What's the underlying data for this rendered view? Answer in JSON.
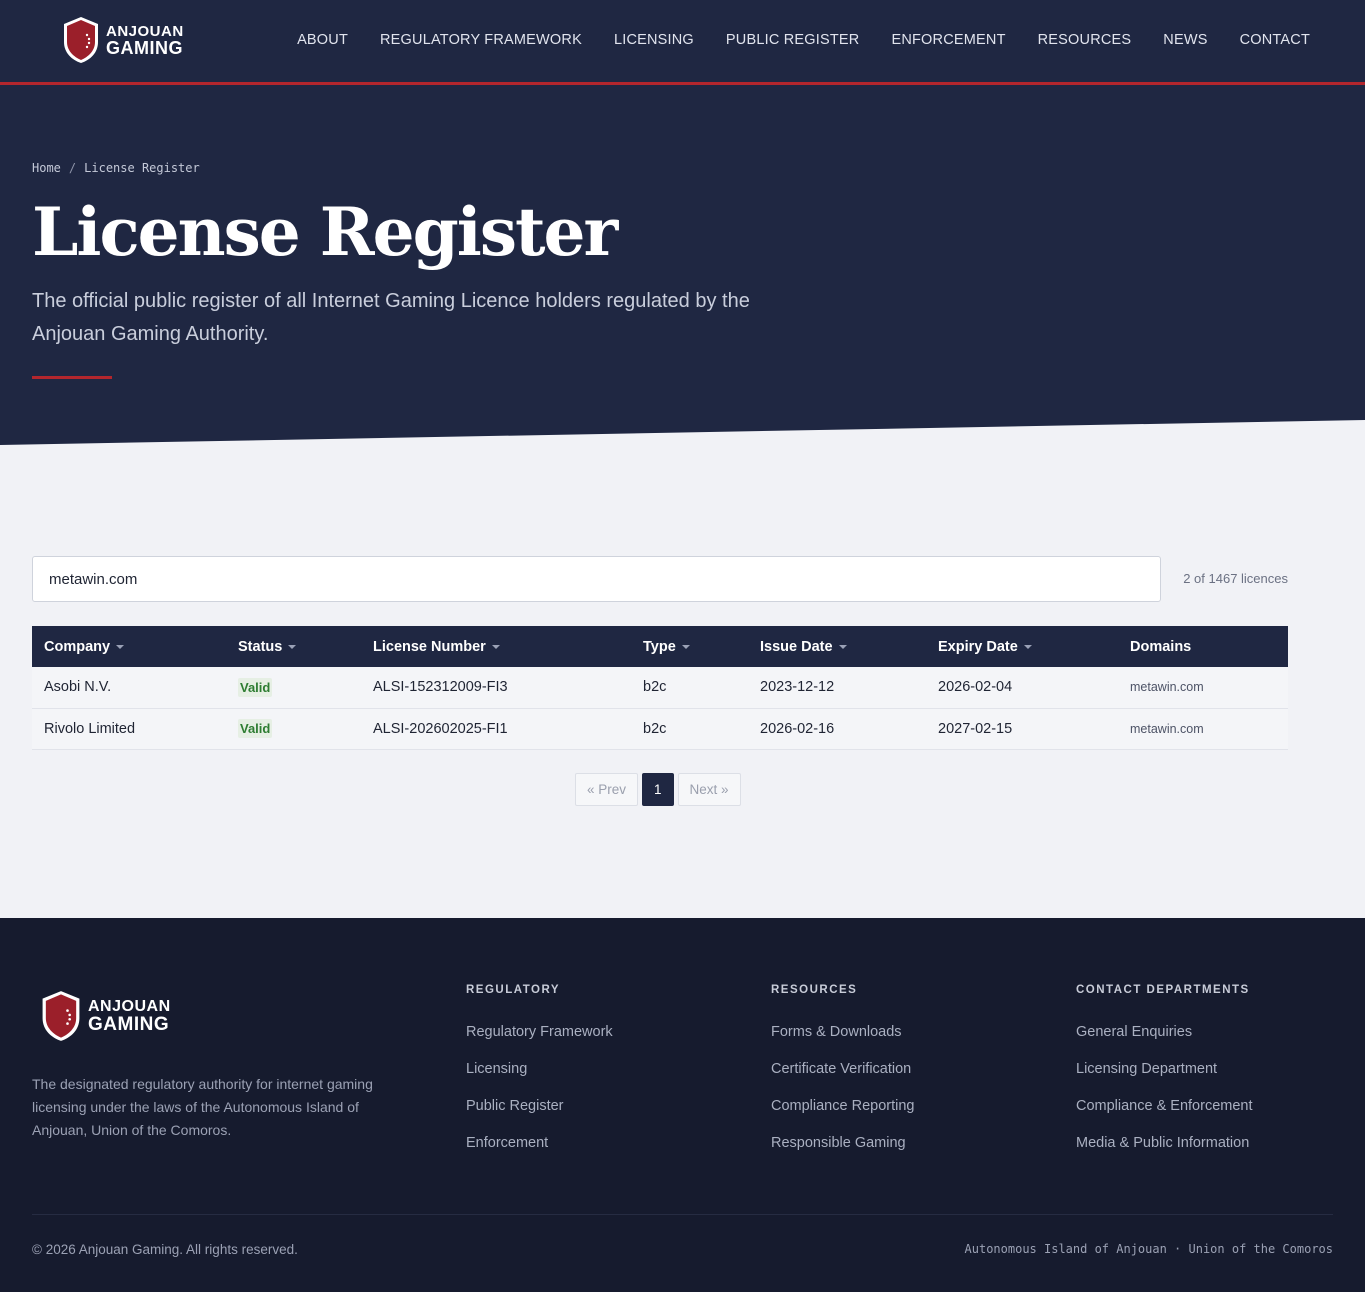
{
  "brand": {
    "line1": "ANJOUAN",
    "line2": "GAMING",
    "primary_color": "#1f2742",
    "accent_color": "#b3262d"
  },
  "nav": [
    "ABOUT",
    "REGULATORY FRAMEWORK",
    "LICENSING",
    "PUBLIC REGISTER",
    "ENFORCEMENT",
    "RESOURCES",
    "NEWS",
    "CONTACT"
  ],
  "breadcrumb": {
    "home": "Home",
    "separator": "/",
    "current": "License Register"
  },
  "hero": {
    "title": "License Register",
    "subtitle": "The official public register of all Internet Gaming Licence holders regulated by the Anjouan Gaming Authority."
  },
  "search": {
    "value": "metawin.com",
    "count": "2 of 1467 licences"
  },
  "table": {
    "columns": [
      "Company",
      "Status",
      "License Number",
      "Type",
      "Issue Date",
      "Expiry Date",
      "Domains"
    ],
    "rows": [
      {
        "company": "Asobi N.V.",
        "status": "Valid",
        "license": "ALSI-152312009-FI3",
        "type": "b2c",
        "issue": "2023-12-12",
        "expiry": "2026-02-04",
        "domains": "metawin.com"
      },
      {
        "company": "Rivolo Limited",
        "status": "Valid",
        "license": "ALSI-202602025-FI1",
        "type": "b2c",
        "issue": "2026-02-16",
        "expiry": "2027-02-15",
        "domains": "metawin.com"
      }
    ],
    "status_color": "#2e7d32"
  },
  "pagination": {
    "prev": "« Prev",
    "current": "1",
    "next": "Next »"
  },
  "footer": {
    "description": "The designated regulatory authority for internet gaming licensing under the laws of the Autonomous Island of Anjouan, Union of the Comoros.",
    "columns": [
      {
        "heading": "REGULATORY",
        "links": [
          "Regulatory Framework",
          "Licensing",
          "Public Register",
          "Enforcement"
        ]
      },
      {
        "heading": "RESOURCES",
        "links": [
          "Forms & Downloads",
          "Certificate Verification",
          "Compliance Reporting",
          "Responsible Gaming"
        ]
      },
      {
        "heading": "CONTACT DEPARTMENTS",
        "links": [
          "General Enquiries",
          "Licensing Department",
          "Compliance & Enforcement",
          "Media & Public Information"
        ]
      }
    ],
    "copyright": "© 2026 Anjouan Gaming. All rights reserved.",
    "location": "Autonomous Island of Anjouan · Union of the Comoros"
  }
}
